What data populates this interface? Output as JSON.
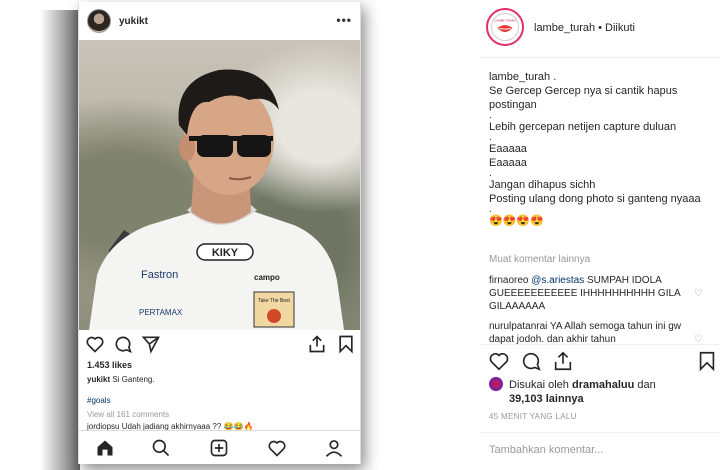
{
  "phone": {
    "username": "yukikt",
    "more_icon": "more-horizontal-icon",
    "likes": "1.453 likes",
    "caption_user": "yukikt",
    "caption_text": " Si Ganteng.",
    "hashtag": "#goals",
    "view_all": "View all 161 comments",
    "partial_comment": "jordiopsu Udah jadiang akhirnyaaa ?? 😂😂🔥",
    "jersey_text": "KIKY",
    "sponsor1": "Fastron",
    "sponsor2": "PERTAMAX",
    "sponsor3": "campo",
    "badge_text": "Take The Best"
  },
  "header": {
    "username": "lambe_turah",
    "dot": "•",
    "follow_status": "Diikuti",
    "avatar_text": "LAMBE TURAH"
  },
  "caption": {
    "lines": [
      "lambe_turah .",
      "Se Gercep Gercep nya si cantik hapus",
      "postingan",
      ".",
      "Lebih gercepan netijen capture duluan",
      ".",
      "Eaaaaa",
      "Eaaaaa",
      ".",
      "Jangan dihapus sichh",
      "Posting ulang dong photo si ganteng nyaaa",
      ".",
      "😍😍😍😍"
    ]
  },
  "comments": {
    "load_more": "Muat komentar lainnya",
    "c1_user": "firnaoreo",
    "c1_mention": "@s.ariestas",
    "c1_text": " SUMPAH IDOLA GUEEEEEEEEEEE IHHHHHHHHHH GILA GILAAAAAA",
    "c2_user": "nurulpatanrai",
    "c2_text": " YA Allah semoga tahun ini gw dapat jodoh. dan akhir tahun"
  },
  "likes": {
    "prefix": "Disukai oleh ",
    "user": "dramahaluu",
    "and": " dan",
    "count": "39,103",
    "suffix": " lainnya"
  },
  "time": "45 MENIT YANG LALU",
  "add_comment": {
    "placeholder": "Tambahkan komentar...",
    "post": ""
  }
}
